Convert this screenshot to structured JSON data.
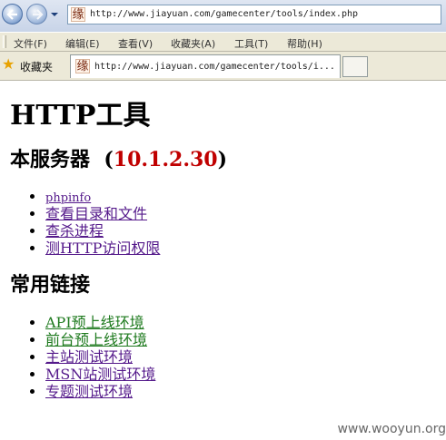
{
  "browser": {
    "address_url": "http://www.jiayuan.com/gamecenter/tools/index.php",
    "page_icon_glyph": "缘",
    "menu": [
      {
        "label": "文件(F)"
      },
      {
        "label": "编辑(E)"
      },
      {
        "label": "查看(V)"
      },
      {
        "label": "收藏夹(A)"
      },
      {
        "label": "工具(T)"
      },
      {
        "label": "帮助(H)"
      }
    ],
    "favorites_label": "收藏夹",
    "tab_title": "http://www.jiayuan.com/gamecenter/tools/i..."
  },
  "page": {
    "title": "HTTP工具",
    "server_heading": "本服务器",
    "server_ip": "10.1.2.30",
    "server_links": [
      {
        "label": "phpinfo"
      },
      {
        "label": "查看目录和文件"
      },
      {
        "label": "查杀进程"
      },
      {
        "label": "测HTTP访问权限"
      }
    ],
    "links_heading": "常用链接",
    "common_links": [
      {
        "label": "API预上线环境"
      },
      {
        "label": "前台预上线环境"
      },
      {
        "label": "主站测试环境"
      },
      {
        "label": "MSN站测试环境"
      },
      {
        "label": "专题测试环境"
      }
    ]
  },
  "watermark": "www.wooyun.org",
  "colors": {
    "ip": "#c00000",
    "visited_link": "#551a8b",
    "green_link": "#1e7a1e"
  }
}
